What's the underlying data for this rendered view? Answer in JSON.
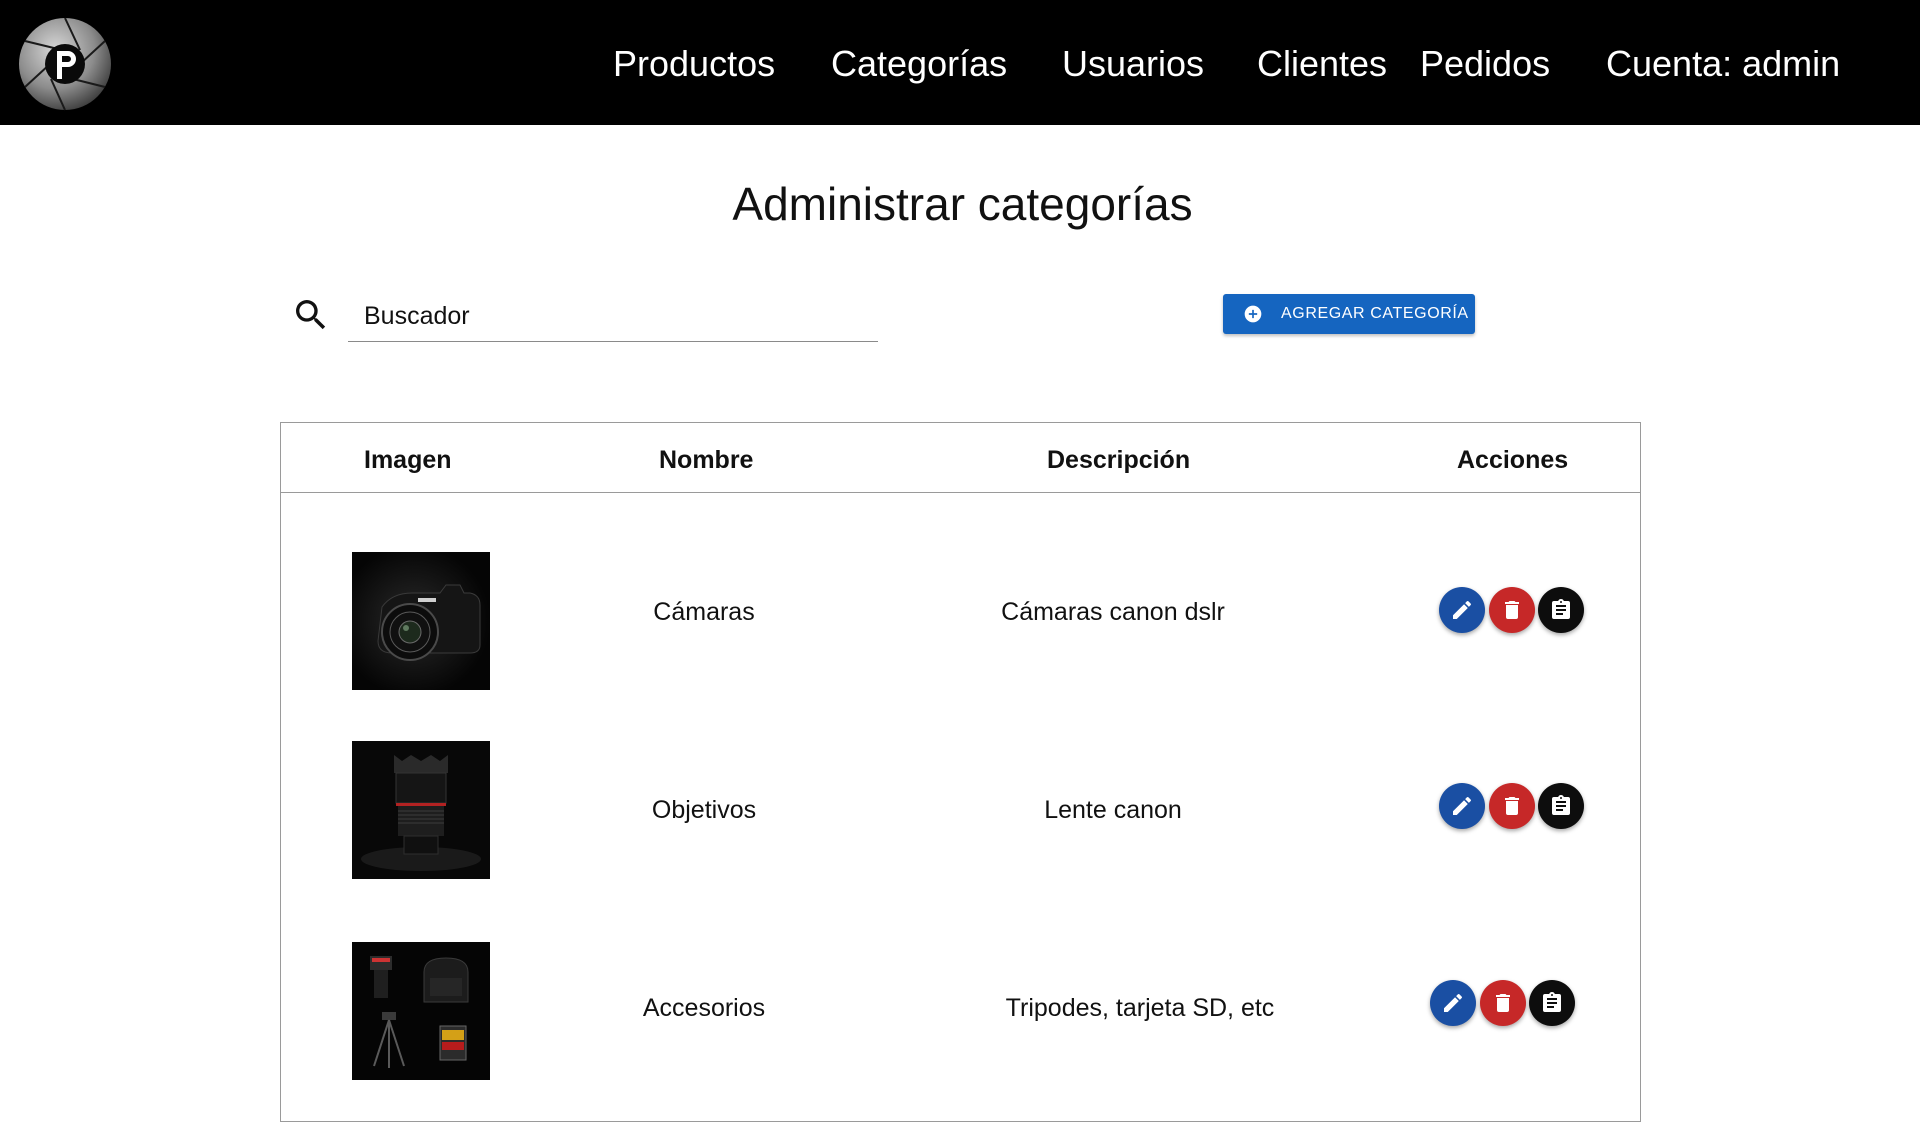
{
  "nav": {
    "items": [
      "Productos",
      "Categorías",
      "Usuarios",
      "Clientes",
      "Pedidos"
    ],
    "account": "Cuenta: admin"
  },
  "page": {
    "title": "Administrar categorías"
  },
  "search": {
    "placeholder": "Buscador",
    "icon": "search-icon"
  },
  "toolbar": {
    "add_label": "AGREGAR CATEGORÍA",
    "add_icon": "plus-circle-icon",
    "accent": "#1565c0"
  },
  "table": {
    "columns": [
      "Imagen",
      "Nombre",
      "Descripción",
      "Acciones"
    ],
    "rows": [
      {
        "image": "camera-photo",
        "name": "Cámaras",
        "description": "Cámaras canon dslr"
      },
      {
        "image": "lens-photo",
        "name": "Objetivos",
        "description": "Lente canon"
      },
      {
        "image": "accessories-photo",
        "name": "Accesorios",
        "description": "Tripodes, tarjeta SD, etc"
      }
    ],
    "actions": [
      {
        "icon": "pencil-icon",
        "color": "#1a4fa3"
      },
      {
        "icon": "trash-icon",
        "color": "#c62828"
      },
      {
        "icon": "clipboard-icon",
        "color": "#0d0d0d"
      }
    ]
  }
}
